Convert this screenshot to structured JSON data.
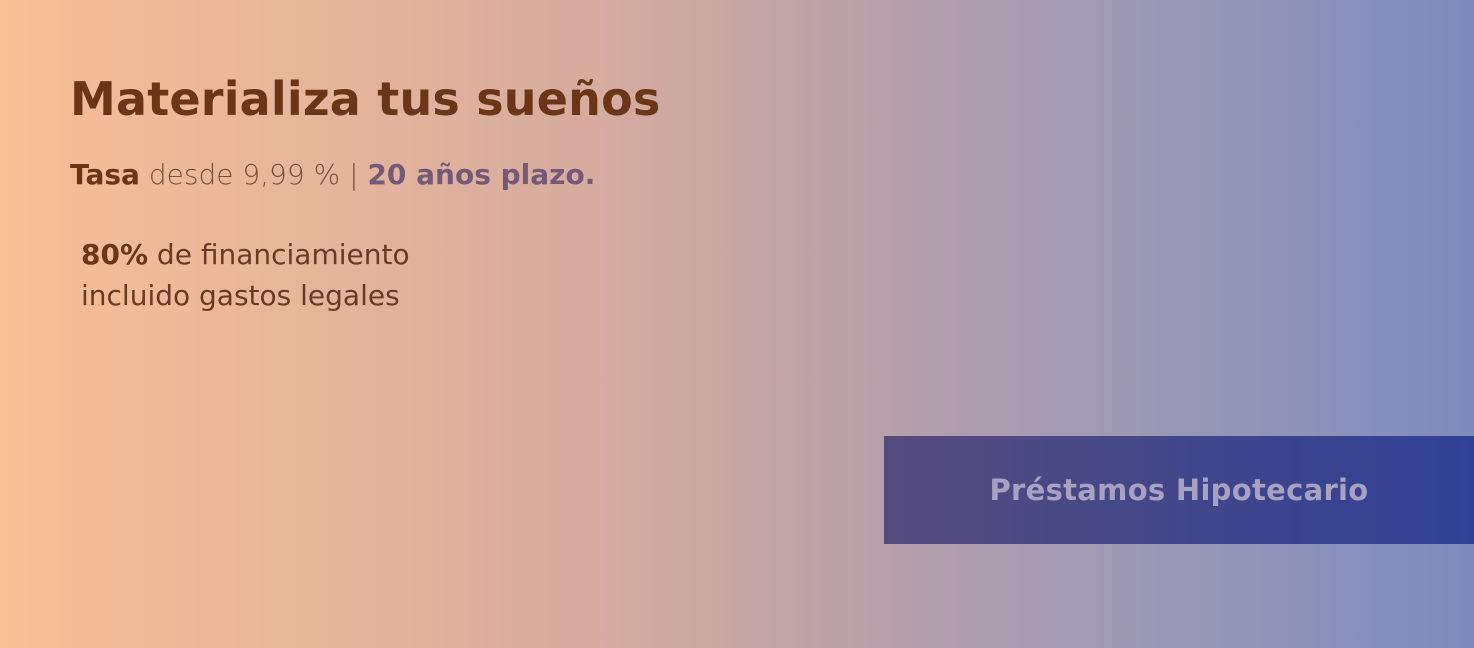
{
  "banner": {
    "colors": {
      "gradient_start": "#f9bf95",
      "gradient_end": "#7d8abe",
      "headline": "#6b3618",
      "accent_purple": "#735a79",
      "button_start": "#554b7d",
      "button_end": "#2f4196",
      "button_text": "#a8a1c2"
    },
    "headline": "Materializa tus sueños",
    "rate": {
      "label": "Tasa",
      "text": " desde 9,99 % | ",
      "term": "20 años plazo."
    },
    "financing": {
      "percent": "80%",
      "line1_rest": " de financiamiento",
      "line2": "incluido gastos legales"
    },
    "cta": {
      "label": "Préstamos Hipotecario"
    }
  }
}
